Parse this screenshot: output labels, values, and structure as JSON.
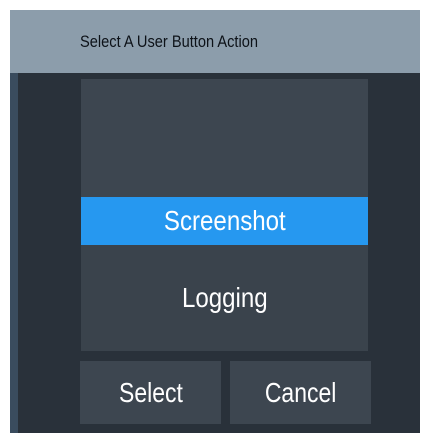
{
  "dialog": {
    "title": "Select A User Button Action"
  },
  "list": {
    "items": [
      {
        "label": "Screenshot",
        "selected": true
      },
      {
        "label": "Logging",
        "selected": false
      }
    ]
  },
  "buttons": {
    "select_label": "Select",
    "cancel_label": "Cancel"
  },
  "colors": {
    "title_bar": "#8c9dab",
    "background": "#29313a",
    "list_bg": "#3d4650",
    "selection": "#2698f0",
    "text": "#ffffff"
  }
}
